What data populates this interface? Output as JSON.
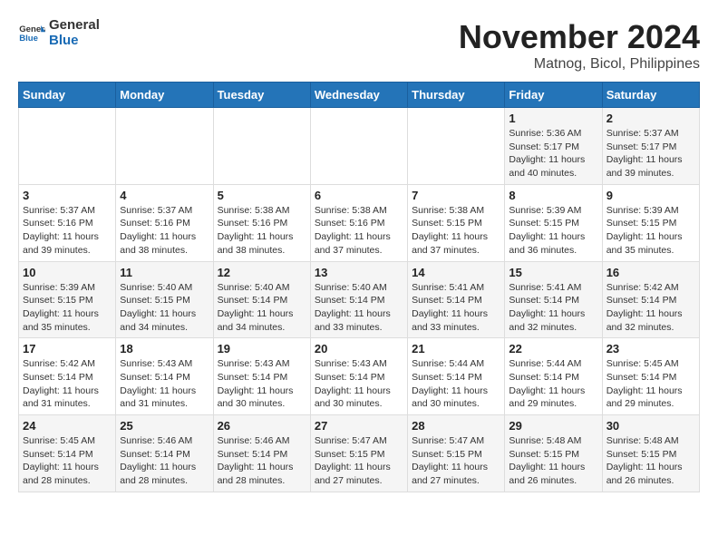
{
  "logo": {
    "text_general": "General",
    "text_blue": "Blue"
  },
  "title": {
    "month_year": "November 2024",
    "location": "Matnog, Bicol, Philippines"
  },
  "weekdays": [
    "Sunday",
    "Monday",
    "Tuesday",
    "Wednesday",
    "Thursday",
    "Friday",
    "Saturday"
  ],
  "weeks": [
    [
      {
        "day": "",
        "info": ""
      },
      {
        "day": "",
        "info": ""
      },
      {
        "day": "",
        "info": ""
      },
      {
        "day": "",
        "info": ""
      },
      {
        "day": "",
        "info": ""
      },
      {
        "day": "1",
        "info": "Sunrise: 5:36 AM\nSunset: 5:17 PM\nDaylight: 11 hours\nand 40 minutes."
      },
      {
        "day": "2",
        "info": "Sunrise: 5:37 AM\nSunset: 5:17 PM\nDaylight: 11 hours\nand 39 minutes."
      }
    ],
    [
      {
        "day": "3",
        "info": "Sunrise: 5:37 AM\nSunset: 5:16 PM\nDaylight: 11 hours\nand 39 minutes."
      },
      {
        "day": "4",
        "info": "Sunrise: 5:37 AM\nSunset: 5:16 PM\nDaylight: 11 hours\nand 38 minutes."
      },
      {
        "day": "5",
        "info": "Sunrise: 5:38 AM\nSunset: 5:16 PM\nDaylight: 11 hours\nand 38 minutes."
      },
      {
        "day": "6",
        "info": "Sunrise: 5:38 AM\nSunset: 5:16 PM\nDaylight: 11 hours\nand 37 minutes."
      },
      {
        "day": "7",
        "info": "Sunrise: 5:38 AM\nSunset: 5:15 PM\nDaylight: 11 hours\nand 37 minutes."
      },
      {
        "day": "8",
        "info": "Sunrise: 5:39 AM\nSunset: 5:15 PM\nDaylight: 11 hours\nand 36 minutes."
      },
      {
        "day": "9",
        "info": "Sunrise: 5:39 AM\nSunset: 5:15 PM\nDaylight: 11 hours\nand 35 minutes."
      }
    ],
    [
      {
        "day": "10",
        "info": "Sunrise: 5:39 AM\nSunset: 5:15 PM\nDaylight: 11 hours\nand 35 minutes."
      },
      {
        "day": "11",
        "info": "Sunrise: 5:40 AM\nSunset: 5:15 PM\nDaylight: 11 hours\nand 34 minutes."
      },
      {
        "day": "12",
        "info": "Sunrise: 5:40 AM\nSunset: 5:14 PM\nDaylight: 11 hours\nand 34 minutes."
      },
      {
        "day": "13",
        "info": "Sunrise: 5:40 AM\nSunset: 5:14 PM\nDaylight: 11 hours\nand 33 minutes."
      },
      {
        "day": "14",
        "info": "Sunrise: 5:41 AM\nSunset: 5:14 PM\nDaylight: 11 hours\nand 33 minutes."
      },
      {
        "day": "15",
        "info": "Sunrise: 5:41 AM\nSunset: 5:14 PM\nDaylight: 11 hours\nand 32 minutes."
      },
      {
        "day": "16",
        "info": "Sunrise: 5:42 AM\nSunset: 5:14 PM\nDaylight: 11 hours\nand 32 minutes."
      }
    ],
    [
      {
        "day": "17",
        "info": "Sunrise: 5:42 AM\nSunset: 5:14 PM\nDaylight: 11 hours\nand 31 minutes."
      },
      {
        "day": "18",
        "info": "Sunrise: 5:43 AM\nSunset: 5:14 PM\nDaylight: 11 hours\nand 31 minutes."
      },
      {
        "day": "19",
        "info": "Sunrise: 5:43 AM\nSunset: 5:14 PM\nDaylight: 11 hours\nand 30 minutes."
      },
      {
        "day": "20",
        "info": "Sunrise: 5:43 AM\nSunset: 5:14 PM\nDaylight: 11 hours\nand 30 minutes."
      },
      {
        "day": "21",
        "info": "Sunrise: 5:44 AM\nSunset: 5:14 PM\nDaylight: 11 hours\nand 30 minutes."
      },
      {
        "day": "22",
        "info": "Sunrise: 5:44 AM\nSunset: 5:14 PM\nDaylight: 11 hours\nand 29 minutes."
      },
      {
        "day": "23",
        "info": "Sunrise: 5:45 AM\nSunset: 5:14 PM\nDaylight: 11 hours\nand 29 minutes."
      }
    ],
    [
      {
        "day": "24",
        "info": "Sunrise: 5:45 AM\nSunset: 5:14 PM\nDaylight: 11 hours\nand 28 minutes."
      },
      {
        "day": "25",
        "info": "Sunrise: 5:46 AM\nSunset: 5:14 PM\nDaylight: 11 hours\nand 28 minutes."
      },
      {
        "day": "26",
        "info": "Sunrise: 5:46 AM\nSunset: 5:14 PM\nDaylight: 11 hours\nand 28 minutes."
      },
      {
        "day": "27",
        "info": "Sunrise: 5:47 AM\nSunset: 5:15 PM\nDaylight: 11 hours\nand 27 minutes."
      },
      {
        "day": "28",
        "info": "Sunrise: 5:47 AM\nSunset: 5:15 PM\nDaylight: 11 hours\nand 27 minutes."
      },
      {
        "day": "29",
        "info": "Sunrise: 5:48 AM\nSunset: 5:15 PM\nDaylight: 11 hours\nand 26 minutes."
      },
      {
        "day": "30",
        "info": "Sunrise: 5:48 AM\nSunset: 5:15 PM\nDaylight: 11 hours\nand 26 minutes."
      }
    ]
  ]
}
